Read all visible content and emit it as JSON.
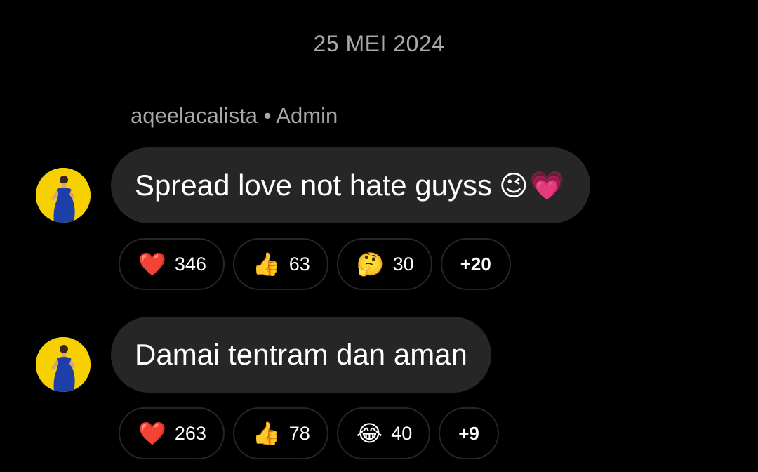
{
  "date_separator": "25 MEI 2024",
  "sender": {
    "name": "aqeelacalista",
    "separator": "•",
    "role": "Admin"
  },
  "messages": [
    {
      "text": "Spread love not hate guyss",
      "emojis": "😉💗",
      "reactions": [
        {
          "emoji": "❤️",
          "icon": "heart-icon",
          "count": "346"
        },
        {
          "emoji": "👍",
          "icon": "thumbs-up-icon",
          "count": "63"
        },
        {
          "emoji": "🤔",
          "icon": "thinking-face-icon",
          "count": "30"
        }
      ],
      "more": "+20"
    },
    {
      "text": "Damai tentram dan aman",
      "emojis": "",
      "reactions": [
        {
          "emoji": "❤️",
          "icon": "heart-icon",
          "count": "263"
        },
        {
          "emoji": "👍",
          "icon": "thumbs-up-icon",
          "count": "78"
        },
        {
          "emoji": "😂",
          "icon": "tears-of-joy-icon",
          "count": "40"
        }
      ],
      "more": "+9"
    }
  ]
}
